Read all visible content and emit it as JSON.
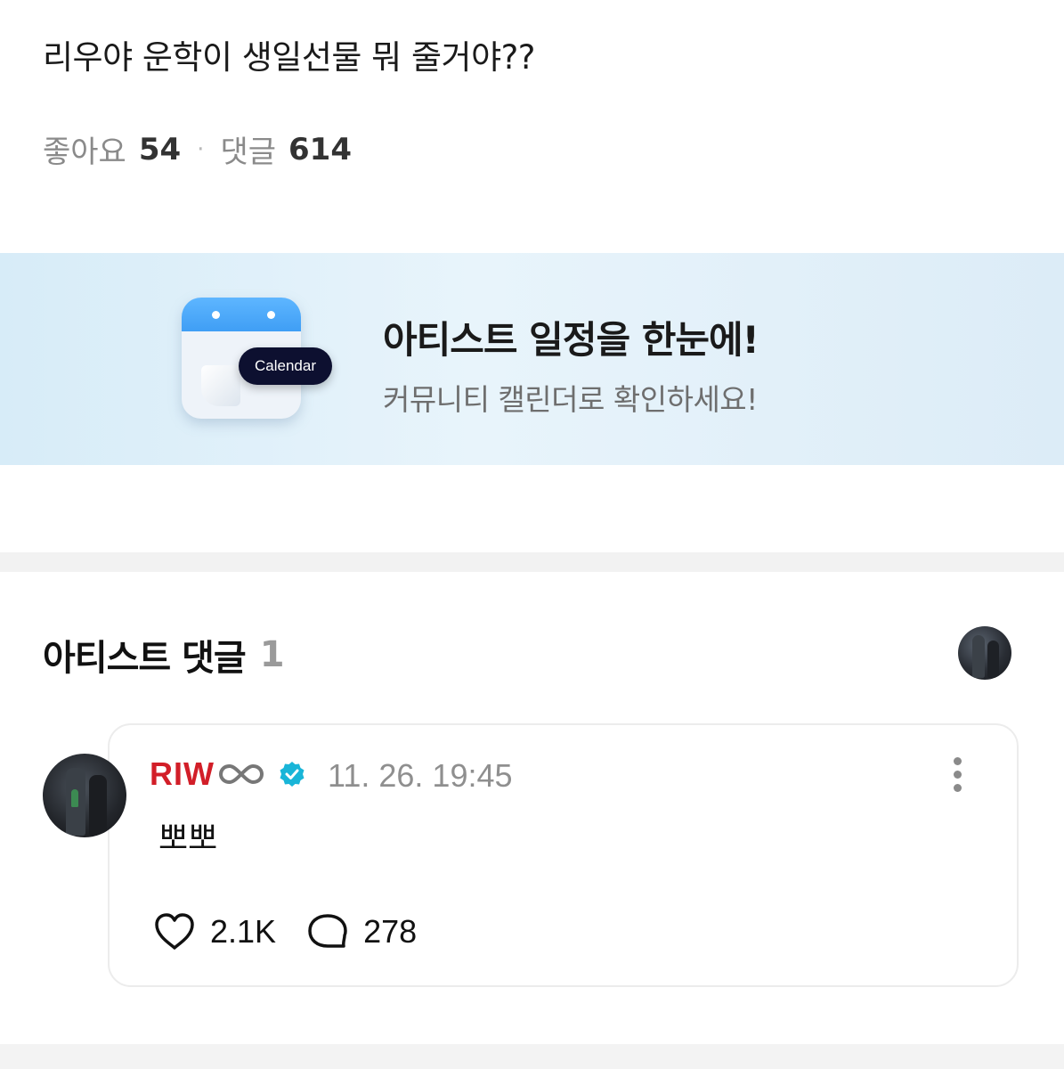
{
  "post": {
    "title": "리우야 운학이 생일선물 뭐 줄거야??",
    "likes_label": "좋아요",
    "likes_count": "54",
    "separator": "·",
    "comments_label": "댓글",
    "comments_count": "614"
  },
  "banner": {
    "icon": "calendar-icon",
    "pill_label": "Calendar",
    "title": "아티스트 일정을 한눈에!",
    "subtitle": "커뮤니티 캘린더로 확인하세요!",
    "accent_color": "#3f9ef5"
  },
  "artist_comments": {
    "heading": "아티스트 댓글",
    "count": "1",
    "comments": [
      {
        "author": "RIW",
        "author_color": "#d21e28",
        "time": "11. 26. 19:45",
        "text": "뽀뽀",
        "likes": "2.1K",
        "replies": "278",
        "verified_color": "#19b5d8"
      }
    ]
  }
}
